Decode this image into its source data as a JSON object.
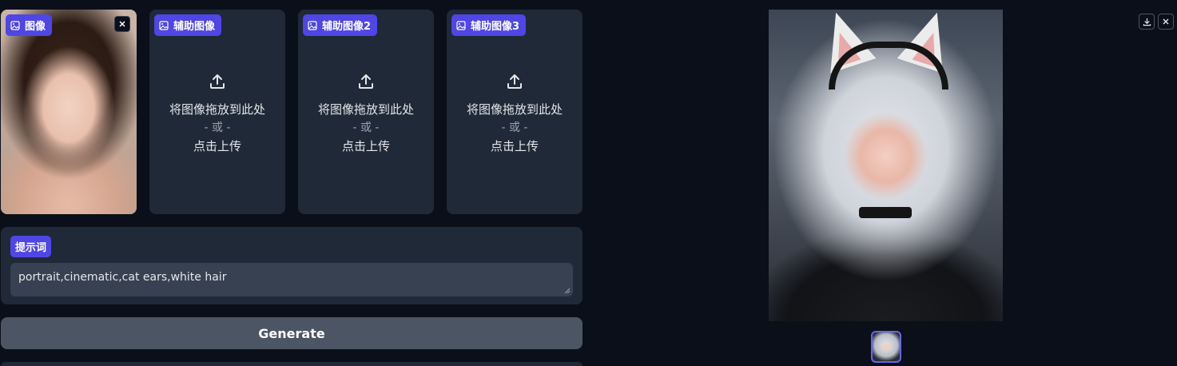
{
  "inputs": {
    "image": {
      "label": "图像"
    },
    "aux1": {
      "label": "辅助图像"
    },
    "aux2": {
      "label": "辅助图像2"
    },
    "aux3": {
      "label": "辅助图像3"
    },
    "upload": {
      "drop_text": "将图像拖放到此处",
      "or_text": "- 或 -",
      "click_text": "点击上传"
    }
  },
  "prompt": {
    "label": "提示词",
    "value": "portrait,cinematic,cat ears,white hair"
  },
  "generate": {
    "label": "Generate"
  },
  "colors": {
    "background": "#0b0f19",
    "panel": "#1f2937",
    "accent": "#4f46e5",
    "button": "#4b5563",
    "input": "#374151"
  },
  "icons": [
    "image-icon",
    "close-icon",
    "upload-icon",
    "download-icon"
  ]
}
